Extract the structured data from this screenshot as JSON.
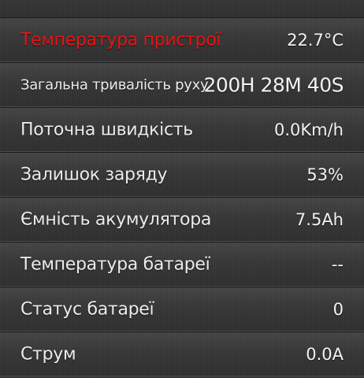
{
  "rows": [
    {
      "label": "",
      "value": ""
    },
    {
      "label": "Температура пристрої",
      "value": "22.7°C"
    },
    {
      "label": "Загальна тривалість руху",
      "value": "200H 28M 40S"
    },
    {
      "label": "Поточна швидкість",
      "value": "0.0Km/h"
    },
    {
      "label": "Залишок заряду",
      "value": "53%"
    },
    {
      "label": "Ємність акумулятора",
      "value": "7.5Ah"
    },
    {
      "label": "Температура батареї",
      "value": "--"
    },
    {
      "label": "Статус батареї",
      "value": "0"
    },
    {
      "label": "Струм",
      "value": "0.0A"
    }
  ],
  "colors": {
    "alert_label": "#e21616",
    "text": "#ececec",
    "background": "#333333"
  }
}
